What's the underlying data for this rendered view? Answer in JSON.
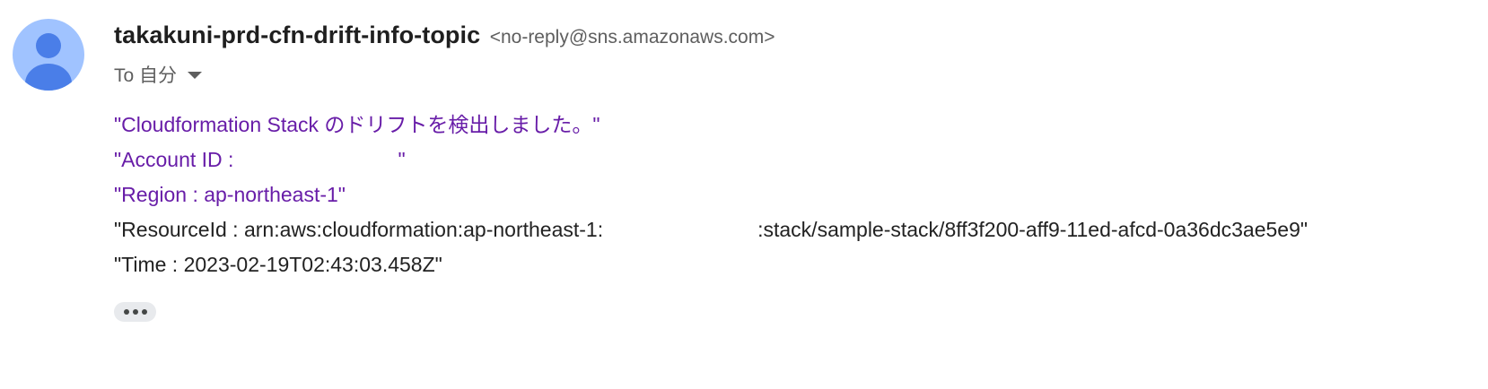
{
  "sender": {
    "name": "takakuni-prd-cfn-drift-info-topic",
    "email": "<no-reply@sns.amazonaws.com>",
    "avatar_icon": "person-icon",
    "avatar_bg": "#a0c3ff",
    "avatar_fg": "#4a7ee8"
  },
  "recipient": {
    "label": "To 自分",
    "dropdown_icon": "caret-down-icon"
  },
  "message": {
    "line1": "\"Cloudformation Stack のドリフトを検出しました。\"",
    "line2_prefix": "\"Account ID :",
    "line2_suffix": "\"",
    "line3": "\"Region : ap-northeast-1\"",
    "line4_prefix": "\"ResourceId : arn:aws:cloudformation:ap-northeast-1:",
    "line4_suffix": ":stack/sample-stack/8ff3f200-aff9-11ed-afcd-0a36dc3ae5e9\"",
    "line5": "\"Time : 2023-02-19T02:43:03.458Z\""
  },
  "colors": {
    "quoted_text": "#681da8",
    "body_text": "#222222"
  },
  "actions": {
    "show_trimmed_icon": "more-horizontal-icon"
  }
}
